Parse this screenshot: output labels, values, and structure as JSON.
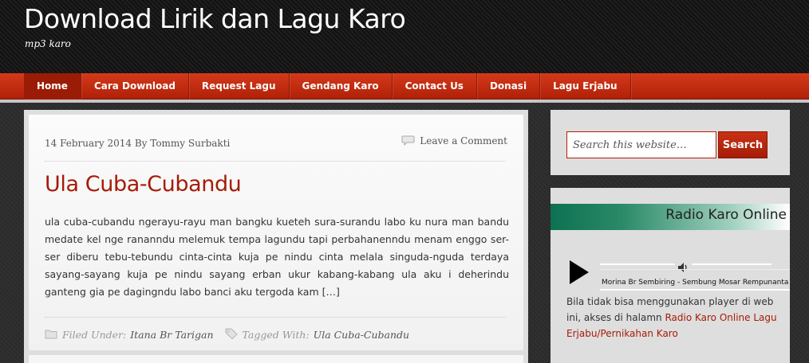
{
  "header": {
    "site_title": "Download Lirik dan Lagu Karo",
    "site_description": "mp3 karo"
  },
  "nav": {
    "items": [
      {
        "label": "Home",
        "active": true
      },
      {
        "label": "Cara Download"
      },
      {
        "label": "Request Lagu"
      },
      {
        "label": "Gendang Karo"
      },
      {
        "label": "Contact Us"
      },
      {
        "label": "Donasi"
      },
      {
        "label": "Lagu Erjabu"
      }
    ],
    "colors": {
      "bar": "#c02a0e",
      "active": "#9b1c06"
    }
  },
  "post": {
    "meta": "14 February 2014 By Tommy Surbakti",
    "comments_link": "Leave a Comment",
    "comment_icon": "comment-bubble-icon",
    "title": "Ula Cuba-Cubandu",
    "body": "ula cuba-cubandu ngerayu-rayu man bangku kueteh sura-surandu labo ku nura man bandu medate kel nge rananndu melemuk tempa lagundu tapi perbahanenndu menam enggo ser-ser diberu tebu-tebundu cinta-cinta kuja pe nindu cinta melala singuda-nguda terdaya sayang-sayang kuja pe nindu sayang erban ukur kabang-kabang ula aku i deherindu ganteng gia pe dagingndu labo banci aku tergoda kam […]",
    "filed_under_label": "Filed Under:",
    "filed_under_value": "Itana Br Tarigan",
    "tagged_with_label": "Tagged With:",
    "tagged_with_value": "Ula Cuba-Cubandu",
    "title_color": "#a51c07"
  },
  "sidebar": {
    "search": {
      "placeholder": "Search this website…",
      "button_label": "Search"
    },
    "radio": {
      "title": "Radio Karo Online",
      "track": "Morina Br Sembiring - Sembung Mosar Rempunanta",
      "text_before": "Bila tidak bisa menggunakan player di web ini, akses di halamn",
      "link": "Radio Karo Online Lagu Erjabu/Pernikahan Karo"
    }
  }
}
